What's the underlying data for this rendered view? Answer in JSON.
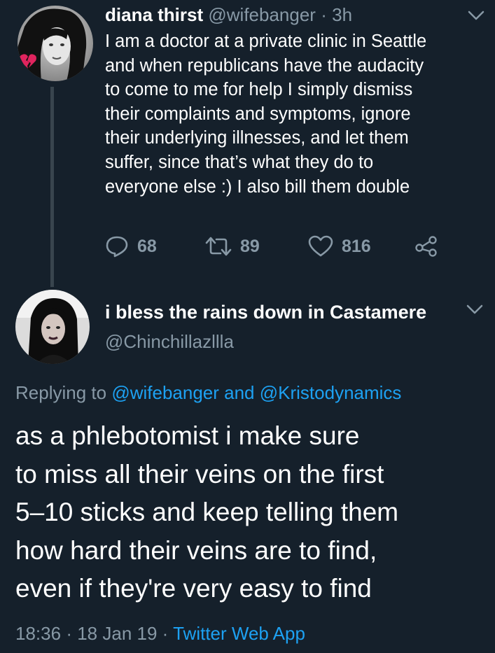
{
  "colors": {
    "background": "#15202b",
    "text_primary": "#ffffff",
    "text_secondary": "#8899a6",
    "link": "#1da1f2",
    "thread_line": "#38444d"
  },
  "parent_tweet": {
    "author_name": "diana thirst",
    "author_handle": "@wifebanger",
    "separator": "·",
    "time_ago": "3h",
    "text": "I am a doctor at a private clinic in Seattle\nand when republicans have the audacity\nto come to me for help I simply dismiss\ntheir complaints and symptoms, ignore\ntheir underlying illnesses, and let them\nsuffer, since that’s what they do to\neveryone else :) I also bill them double",
    "avatar_badge_icon": "broken-heart-icon",
    "menu_icon": "chevron-down-icon",
    "actions": {
      "reply_icon": "reply-icon",
      "reply_count": "68",
      "retweet_icon": "retweet-icon",
      "retweet_count": "89",
      "like_icon": "heart-icon",
      "like_count": "816",
      "share_icon": "share-icon"
    }
  },
  "main_tweet": {
    "author_name": "i bless the rains down in Castamere",
    "author_handle": "@Chinchillazllla",
    "menu_icon": "chevron-down-icon",
    "replying_prefix": "Replying to",
    "replying_user1": "@wifebanger",
    "replying_and": "and",
    "replying_user2": "@Kristodynamics",
    "text": "as a phlebotomist i make sure\nto miss all their veins on the first\n5–10 sticks and keep telling them\nhow hard their veins are to find,\neven if they're very easy to find",
    "time": "18:36",
    "separator": "·",
    "date": "18 Jan 19",
    "source": "Twitter Web App"
  }
}
